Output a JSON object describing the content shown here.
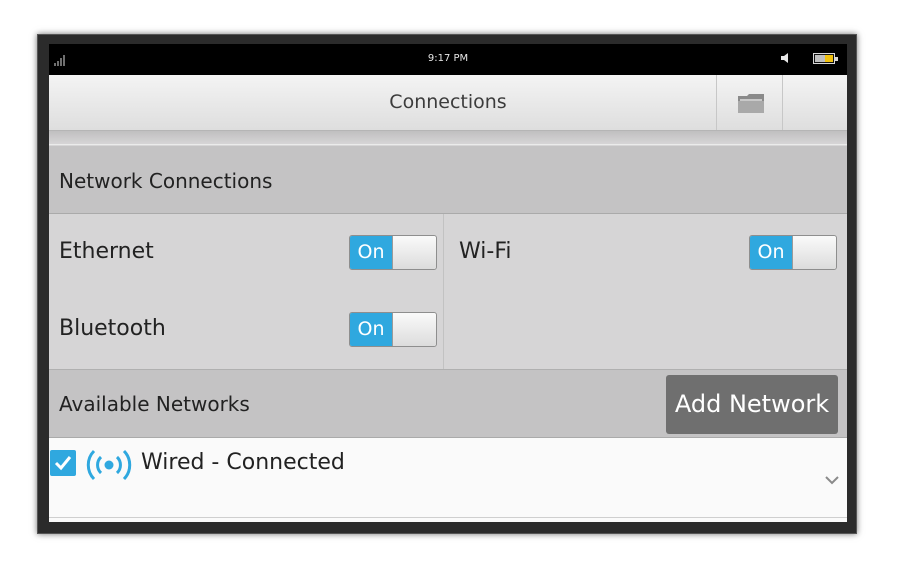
{
  "status_bar": {
    "time": "9:17 PM",
    "signal_icon": "signal-icon",
    "volume_icon": "speaker-icon",
    "battery_icon": "battery-icon"
  },
  "title_bar": {
    "title": "Connections",
    "folder_icon": "folder-icon"
  },
  "network_connections": {
    "header": "Network Connections",
    "toggles": [
      {
        "label": "Ethernet",
        "state": "On"
      },
      {
        "label": "Wi-Fi",
        "state": "On"
      },
      {
        "label": "Bluetooth",
        "state": "On"
      }
    ]
  },
  "available_networks": {
    "header": "Available Networks",
    "add_button": "Add Network",
    "items": [
      {
        "name": "Wired - Connected",
        "checked": true,
        "icon": "wireless-signal-icon"
      }
    ]
  },
  "colors": {
    "accent": "#2fa8df",
    "button_gray": "#6f6f6f",
    "section_header": "#c4c3c4",
    "background": "#d6d5d6"
  }
}
